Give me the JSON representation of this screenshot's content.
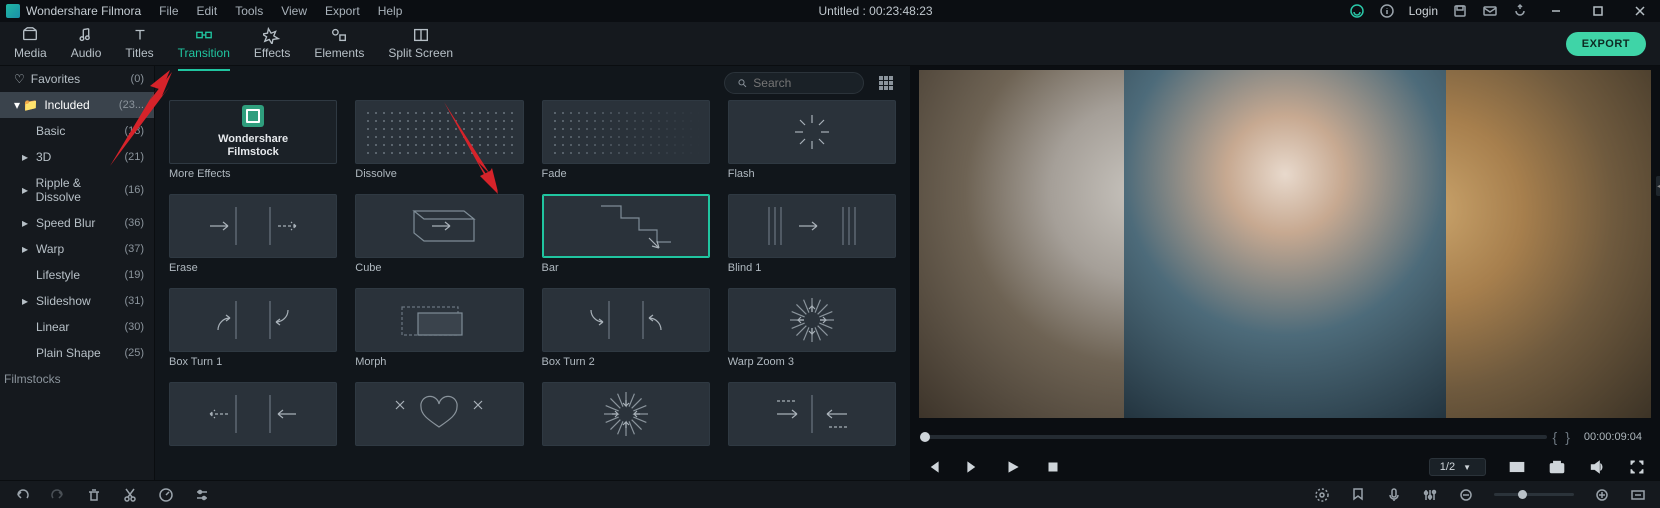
{
  "app": {
    "brand": "Wondershare Filmora"
  },
  "menu": [
    "File",
    "Edit",
    "Tools",
    "View",
    "Export",
    "Help"
  ],
  "title_center": "Untitled : 00:23:48:23",
  "login_label": "Login",
  "tabs": [
    {
      "key": "media",
      "label": "Media"
    },
    {
      "key": "audio",
      "label": "Audio"
    },
    {
      "key": "titles",
      "label": "Titles"
    },
    {
      "key": "transition",
      "label": "Transition",
      "active": true
    },
    {
      "key": "effects",
      "label": "Effects"
    },
    {
      "key": "elements",
      "label": "Elements"
    },
    {
      "key": "splitscreen",
      "label": "Split Screen"
    }
  ],
  "export_label": "EXPORT",
  "search": {
    "placeholder": "Search"
  },
  "sidebar": {
    "favorites": {
      "label": "Favorites",
      "count": "(0)"
    },
    "included": {
      "label": "Included",
      "count": "(23..."
    },
    "items": [
      {
        "label": "Basic",
        "count": "(18)",
        "expand": false
      },
      {
        "label": "3D",
        "count": "(21)",
        "expand": true
      },
      {
        "label": "Ripple & Dissolve",
        "count": "(16)",
        "expand": true
      },
      {
        "label": "Speed Blur",
        "count": "(36)",
        "expand": true
      },
      {
        "label": "Warp",
        "count": "(37)",
        "expand": true
      },
      {
        "label": "Lifestyle",
        "count": "(19)",
        "expand": false
      },
      {
        "label": "Slideshow",
        "count": "(31)",
        "expand": true
      },
      {
        "label": "Linear",
        "count": "(30)",
        "expand": false
      },
      {
        "label": "Plain Shape",
        "count": "(25)",
        "expand": false
      }
    ],
    "filmstocks": "Filmstocks"
  },
  "effects": [
    {
      "label": "More Effects",
      "kind": "filmstock",
      "text1": "Wondershare",
      "text2": "Filmstock"
    },
    {
      "label": "Dissolve",
      "kind": "dots"
    },
    {
      "label": "Fade",
      "kind": "fade"
    },
    {
      "label": "Flash",
      "kind": "flash"
    },
    {
      "label": "Erase",
      "kind": "erase"
    },
    {
      "label": "Cube",
      "kind": "cube"
    },
    {
      "label": "Bar",
      "kind": "bar",
      "selected": true
    },
    {
      "label": "Blind 1",
      "kind": "blind"
    },
    {
      "label": "Box Turn 1",
      "kind": "boxturn"
    },
    {
      "label": "Morph",
      "kind": "morph"
    },
    {
      "label": "Box Turn 2",
      "kind": "boxturn2"
    },
    {
      "label": "Warp Zoom 3",
      "kind": "warpzoom"
    },
    {
      "label": "",
      "kind": "erase2"
    },
    {
      "label": "",
      "kind": "heart"
    },
    {
      "label": "",
      "kind": "warpzoom2"
    },
    {
      "label": "",
      "kind": "arrows4"
    }
  ],
  "preview": {
    "time": "00:00:09:04",
    "ratio": "1/2"
  }
}
